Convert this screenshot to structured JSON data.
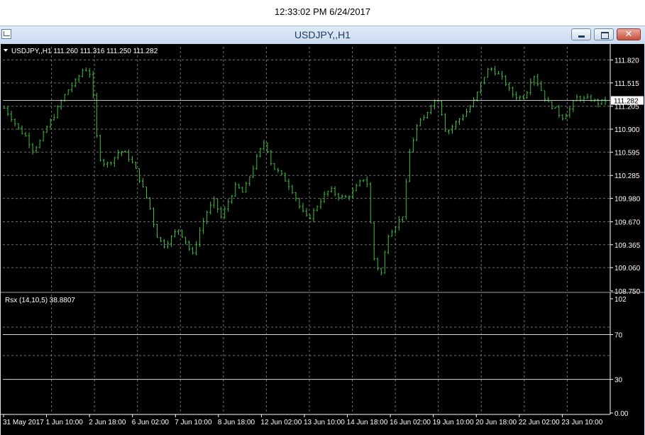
{
  "clock": "12:33:02 PM 6/24/2017",
  "window": {
    "title": "USDJPY,,H1",
    "icons": {
      "app": "chart-window-icon",
      "minimize": "minimize-icon",
      "maximize": "maximize-icon",
      "close": "close-icon"
    },
    "close_glyph": "✕"
  },
  "colors": {
    "background": "#000000",
    "grid": "#c8c8c8",
    "candles": "#3fbf3f",
    "text": "#ffffff",
    "price_line": "#c0c0c0"
  },
  "chart_data": [
    {
      "type": "candlestick",
      "header": "USDJPY,,H1  111.260 111.316 111.250 111.282",
      "price_label": "111.282",
      "current_price": 111.282,
      "ylim": [
        108.75,
        111.9
      ],
      "y_ticks": [
        "111.820",
        "111.515",
        "111.205",
        "110.900",
        "110.595",
        "110.285",
        "109.980",
        "109.670",
        "109.365",
        "109.060",
        "108.750"
      ],
      "x_ticks": [
        "31 May 2017",
        "1 Jun 10:00",
        "2 Jun 18:00",
        "6 Jun 02:00",
        "7 Jun 10:00",
        "8 Jun 18:00",
        "12 Jun 02:00",
        "13 Jun 10:00",
        "14 Jun 18:00",
        "16 Jun 02:00",
        "19 Jun 10:00",
        "20 Jun 18:00",
        "22 Jun 02:00",
        "23 Jun 10:00"
      ],
      "close_path": [
        111.18,
        111.05,
        110.9,
        110.8,
        110.62,
        110.75,
        110.95,
        111.1,
        111.3,
        111.45,
        111.55,
        111.72,
        111.62,
        110.55,
        110.42,
        110.5,
        110.62,
        110.55,
        110.4,
        110.15,
        109.9,
        109.5,
        109.35,
        109.45,
        109.58,
        109.42,
        109.22,
        109.55,
        109.8,
        109.95,
        109.72,
        109.95,
        110.15,
        110.05,
        110.3,
        110.55,
        110.75,
        110.4,
        110.32,
        110.2,
        110.05,
        109.82,
        109.7,
        109.85,
        110.0,
        110.1,
        110.02,
        109.98,
        110.05,
        110.18,
        110.28,
        109.2,
        108.95,
        109.5,
        109.62,
        109.75,
        110.6,
        110.95,
        111.05,
        111.25,
        111.3,
        110.85,
        110.95,
        111.05,
        111.15,
        111.3,
        111.55,
        111.72,
        111.65,
        111.55,
        111.38,
        111.32,
        111.35,
        111.65,
        111.45,
        111.25,
        111.18,
        111.05,
        111.15,
        111.32,
        111.3,
        111.3,
        111.25,
        111.28
      ]
    },
    {
      "type": "line",
      "header": "Rsx (14,10,5) 38.8807",
      "indicator": "Rsx (14,10,5)",
      "last_value": 38.8807,
      "ylim": [
        0,
        102
      ],
      "levels": [
        70,
        30
      ],
      "y_ticks": [
        "102",
        "70",
        "30",
        "0.00"
      ]
    }
  ]
}
